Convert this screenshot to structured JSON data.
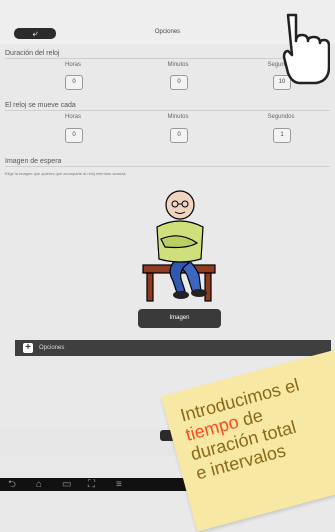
{
  "header": {
    "back_label": "⤶",
    "title": "Opciones"
  },
  "clock_duration": {
    "title": "Duración del reloj",
    "columns": [
      {
        "label": "Horas",
        "value": "0"
      },
      {
        "label": "Minutos",
        "value": "0"
      },
      {
        "label": "Segundos",
        "value": "10"
      }
    ]
  },
  "clock_interval": {
    "title": "El reloj se mueve cada",
    "columns": [
      {
        "label": "Horas",
        "value": "0"
      },
      {
        "label": "Minutos",
        "value": "0"
      },
      {
        "label": "Segundos",
        "value": "1"
      }
    ]
  },
  "wait_image": {
    "title": "Imagen de espera",
    "hint": "Elige la imagen que quieres que acompañe al reloj mientras avanza.",
    "button_label": "Imagen"
  },
  "options_bar": {
    "label": "Opciones",
    "plus": "+"
  },
  "note": {
    "line1": "Introducimos el",
    "line2_highlight": "tiempo",
    "line2_rest": " de",
    "line3": "duración total",
    "line4": "e intervalos"
  },
  "nav_icons": [
    "back-icon",
    "home-icon",
    "recent-apps-icon",
    "screenshot-icon",
    "menu-icon"
  ],
  "colors": {
    "background": "#e9e9e9",
    "dark_button": "#2b2b2b",
    "note": "#f7e8a3",
    "highlight": "#ff4a22"
  }
}
